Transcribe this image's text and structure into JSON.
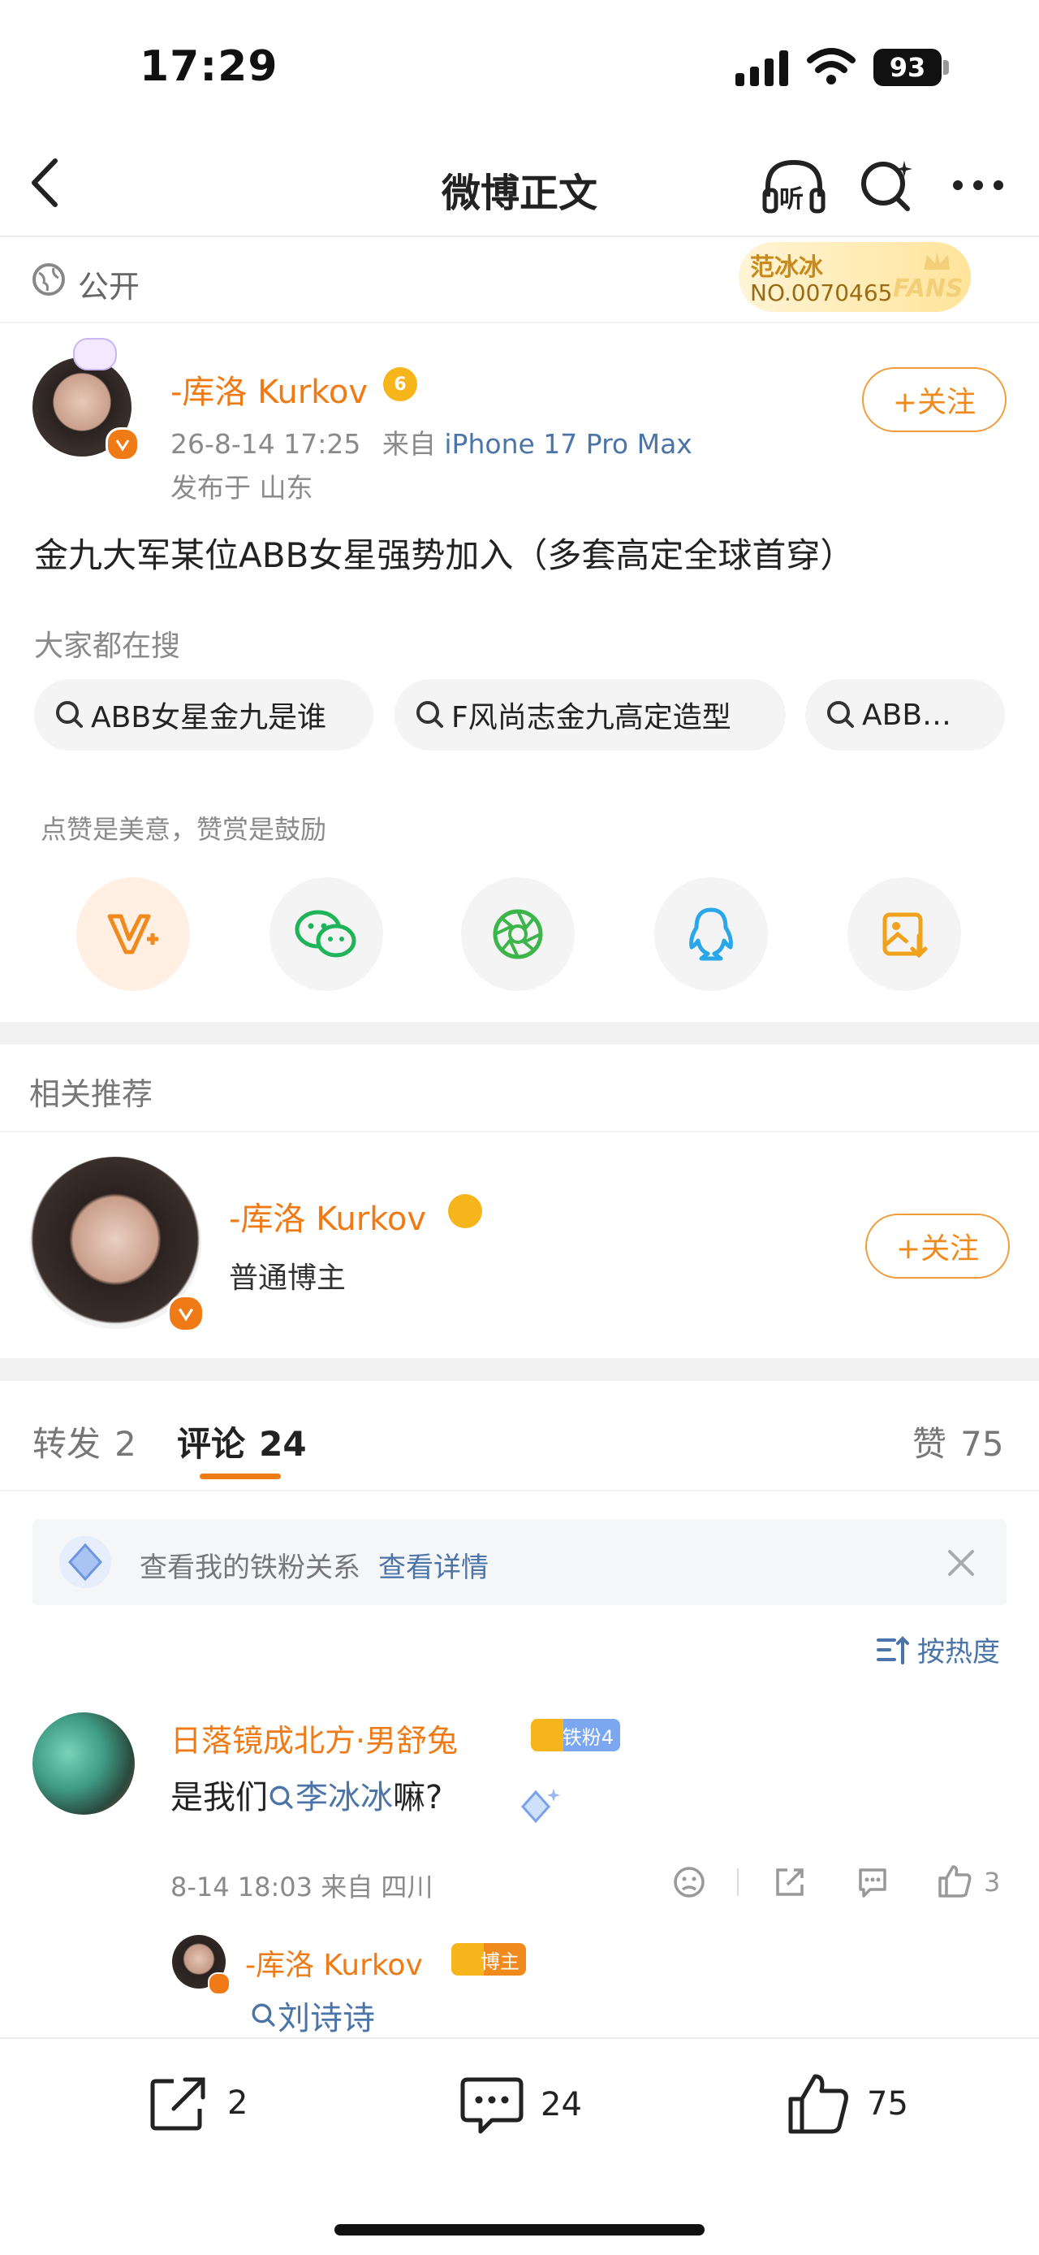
{
  "status_bar": {
    "time": "17:29",
    "battery": "93"
  },
  "nav": {
    "title": "微博正文",
    "listen_label": "听"
  },
  "visibility": {
    "label": "公开"
  },
  "fan_badge": {
    "name": "范冰冰",
    "number": "NO.0070465",
    "watermark": "FANS"
  },
  "post": {
    "author_name": "-库洛 Kurkov",
    "author_level": "6",
    "timestamp": "26-8-14 17:25",
    "source_prefix": "来自",
    "source_device": "iPhone 17 Pro Max",
    "location": "发布于 山东",
    "follow_label": "+关注",
    "text": "金九大军某位ABB女星强势加入（多套高定全球首穿）"
  },
  "search": {
    "heading": "大家都在搜",
    "chips": [
      "ABB女星金九是谁",
      "F风尚志金九高定造型",
      "ABB…"
    ]
  },
  "reward": {
    "hint": "点赞是美意，赞赏是鼓励"
  },
  "share_icons": [
    "reward-v-icon",
    "wechat-icon",
    "moments-icon",
    "qq-icon",
    "save-image-icon"
  ],
  "related": {
    "heading": "相关推荐",
    "name": "-库洛 Kurkov",
    "role": "普通博主",
    "follow_label": "+关注"
  },
  "tabs": {
    "repost_label": "转发",
    "repost_count": "2",
    "comment_label": "评论",
    "comment_count": "24",
    "like_label": "赞",
    "like_count": "75"
  },
  "fan_banner": {
    "text": "查看我的铁粉关系",
    "link": "查看详情"
  },
  "sort": {
    "label": "按热度"
  },
  "comment": {
    "author": "日落镜成北方·男舒兔",
    "badge": "铁粉4",
    "text_prefix": "是我们",
    "link_text": "李冰冰",
    "text_suffix": "嘛?",
    "meta": "8-14 18:03 来自 四川",
    "like_count": "3",
    "reply_author": "-库洛 Kurkov",
    "reply_badge": "博主",
    "reply_link": "刘诗诗"
  },
  "bottom_bar": {
    "repost_count": "2",
    "comment_count": "24",
    "like_count": "75"
  },
  "colors": {
    "accent": "#f08a1c",
    "link": "#4b74a8",
    "divider": "#f1f1f1"
  }
}
